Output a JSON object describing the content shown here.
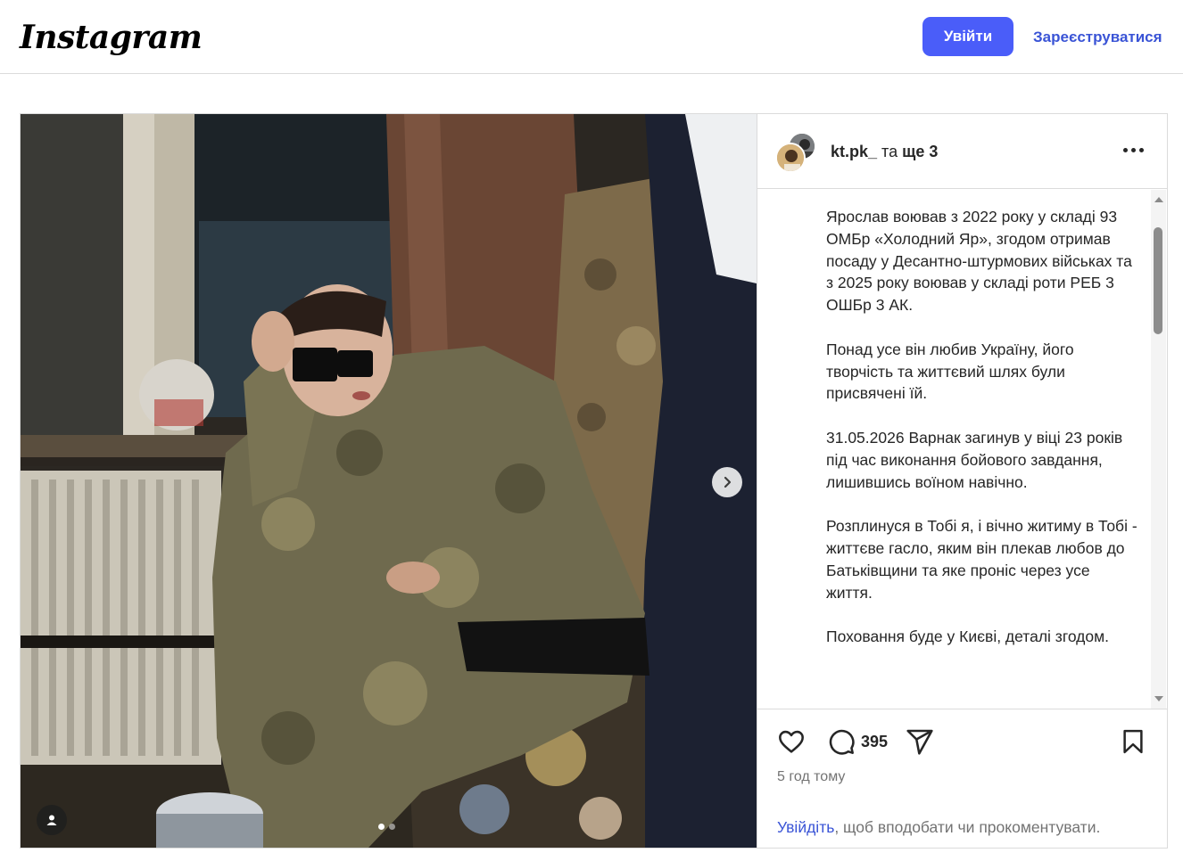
{
  "header": {
    "logo": "Instagram",
    "login_label": "Увійти",
    "signup_label": "Зареєструватися"
  },
  "post": {
    "author": "kt.pk_",
    "conjunction": "та",
    "others": "ще 3",
    "caption": [
      "Ярослав воював з 2022 року у складі 93 ОМБр «Холодний Яр», згодом отримав посаду у Десантно-штурмових військах та з 2025 року воював у складі роти РЕБ 3 ОШБр 3 АК.",
      "Понад усе він любив Україну, його творчість та життєвий шлях були присвячені їй.",
      "31.05.2026 Варнак загинув у віці 23 років під час виконання бойового завдання, лишившись воїном навічно.",
      "Розплинуся в Тобі я, і вічно житиму в Тобі - життєве гасло, яким він плекав любов до Батьківщини та яке проніс через усе життя.",
      "Поховання буде у Києві, деталі згодом."
    ],
    "comment_count": "395",
    "timestamp": "5 год тому",
    "login_prompt_link": "Увійдіть",
    "login_prompt_rest": ", щоб вподобати чи прокоментувати.",
    "carousel": {
      "total": 2,
      "current": 1
    }
  },
  "icons": {
    "like": "heart-icon",
    "comment": "comment-icon",
    "share": "share-icon",
    "save": "bookmark-icon",
    "more": "more-icon",
    "next": "chevron-right-icon",
    "tag": "user-tag-icon"
  },
  "colors": {
    "accent": "#4a5df9",
    "link": "#3a54d6",
    "muted": "#737373",
    "border": "#dbdbdb"
  }
}
